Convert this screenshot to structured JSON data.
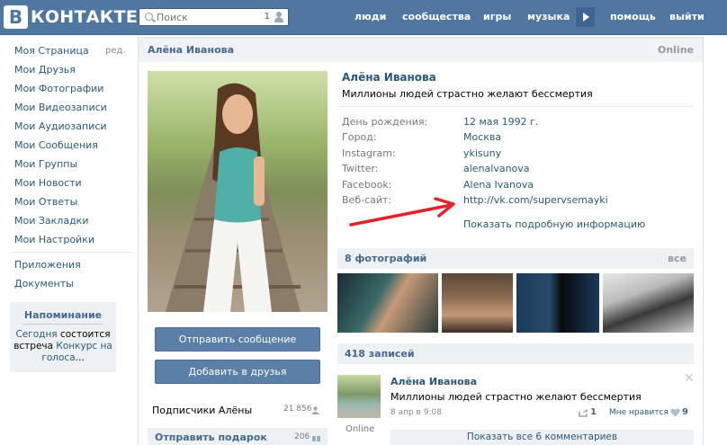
{
  "header": {
    "logo_letter": "В",
    "logo_text": "КОНТАКТЕ",
    "search_placeholder": "Поиск",
    "search_count": "1",
    "nav": [
      "люди",
      "сообщества",
      "игры",
      "музыка",
      "помощь",
      "выйти"
    ]
  },
  "sidebar": {
    "items": [
      "Моя Страница",
      "Мои Друзья",
      "Мои Фотографии",
      "Мои Видеозаписи",
      "Мои Аудиозаписи",
      "Мои Сообщения",
      "Мои Группы",
      "Мои Новости",
      "Мои Ответы",
      "Мои Закладки",
      "Мои Настройки"
    ],
    "edit_label": "ред.",
    "extra": [
      "Приложения",
      "Документы"
    ],
    "reminder": {
      "title": "Напоминание",
      "today": "Сегодня",
      "text1": " состоится встреча ",
      "link": "Конкурс на голоса",
      "tail": "..."
    }
  },
  "profile": {
    "header_name": "Алёна Иванова",
    "online": "Online",
    "name": "Алёна Иванова",
    "status": "Миллионы людей страстно желают бессмертия",
    "info": [
      {
        "label": "День рождения:",
        "value": "12 мая 1992 г."
      },
      {
        "label": "Город:",
        "value": "Москва"
      },
      {
        "label": "Instagram:",
        "value": "ykisuny"
      },
      {
        "label": "Twitter:",
        "value": "alenalvanova"
      },
      {
        "label": "Facebook:",
        "value": "Alena Ivanova"
      },
      {
        "label": "Веб-сайт:",
        "value": "http://vk.com/supervsemayki"
      }
    ],
    "show_more": "Показать подробную информацию",
    "send_message": "Отправить сообщение",
    "add_friend": "Добавить в друзья",
    "subscribers_label": "Подписчики Алёны",
    "subscribers_count": "21 856",
    "gift_label": "Отправить подарок",
    "gift_count": "206"
  },
  "photos": {
    "title": "8 фотографий",
    "all": "все"
  },
  "wall": {
    "title": "418 записей",
    "post": {
      "author": "Алёна Иванова",
      "text": "Миллионы людей страстно желают бессмертия",
      "date": "8 апр в 9:08",
      "reposts": "1",
      "like_label": "Мне нравится",
      "likes": "9",
      "avatar_status": "Online",
      "comments": "Показать все 6 комментариев"
    }
  },
  "colors": {
    "brand": "#4f77a0",
    "link": "#2b587a",
    "arrow": "#e0242a"
  }
}
